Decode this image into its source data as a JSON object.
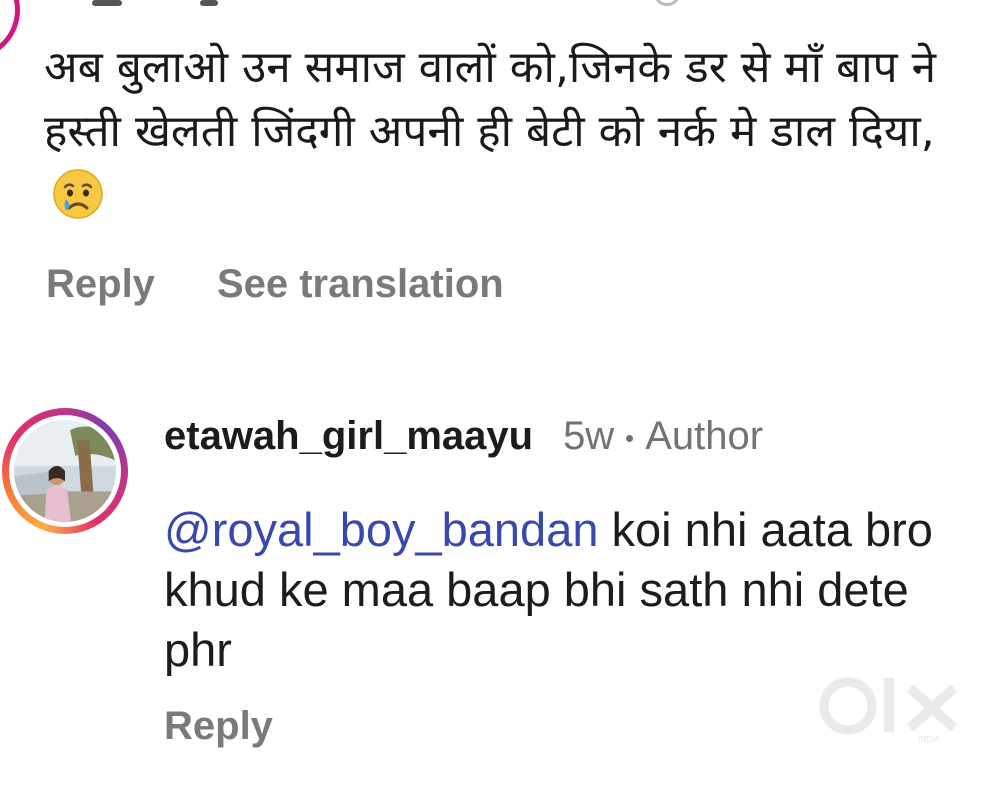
{
  "comment_1": {
    "text": "अब बुलाओ उन समाज वालों को,जिनके डर से माँ बाप ने हस्ती खेलती जिंदगी अपनी ही बेटी को नर्क मे डाल दिया,",
    "emoji": "crying-face-icon",
    "actions": {
      "reply_label": "Reply",
      "translate_label": "See translation"
    }
  },
  "reply_comment": {
    "username": "etawah_girl_maayu",
    "time_ago": "5w",
    "badge": "Author",
    "mention": "@royal_boy_bandan",
    "text": " koi nhi aata bro khud ke maa baap bhi sath nhi dete phr",
    "actions": {
      "reply_label": "Reply"
    }
  },
  "watermark": {
    "brand": "olx",
    "sub": "INDIA"
  },
  "colors": {
    "mention": "#3949ab",
    "muted": "#7a7a7a",
    "text": "#1c1c1c",
    "story_ring_start": "#fcaf45",
    "story_ring_end": "#c13584"
  }
}
